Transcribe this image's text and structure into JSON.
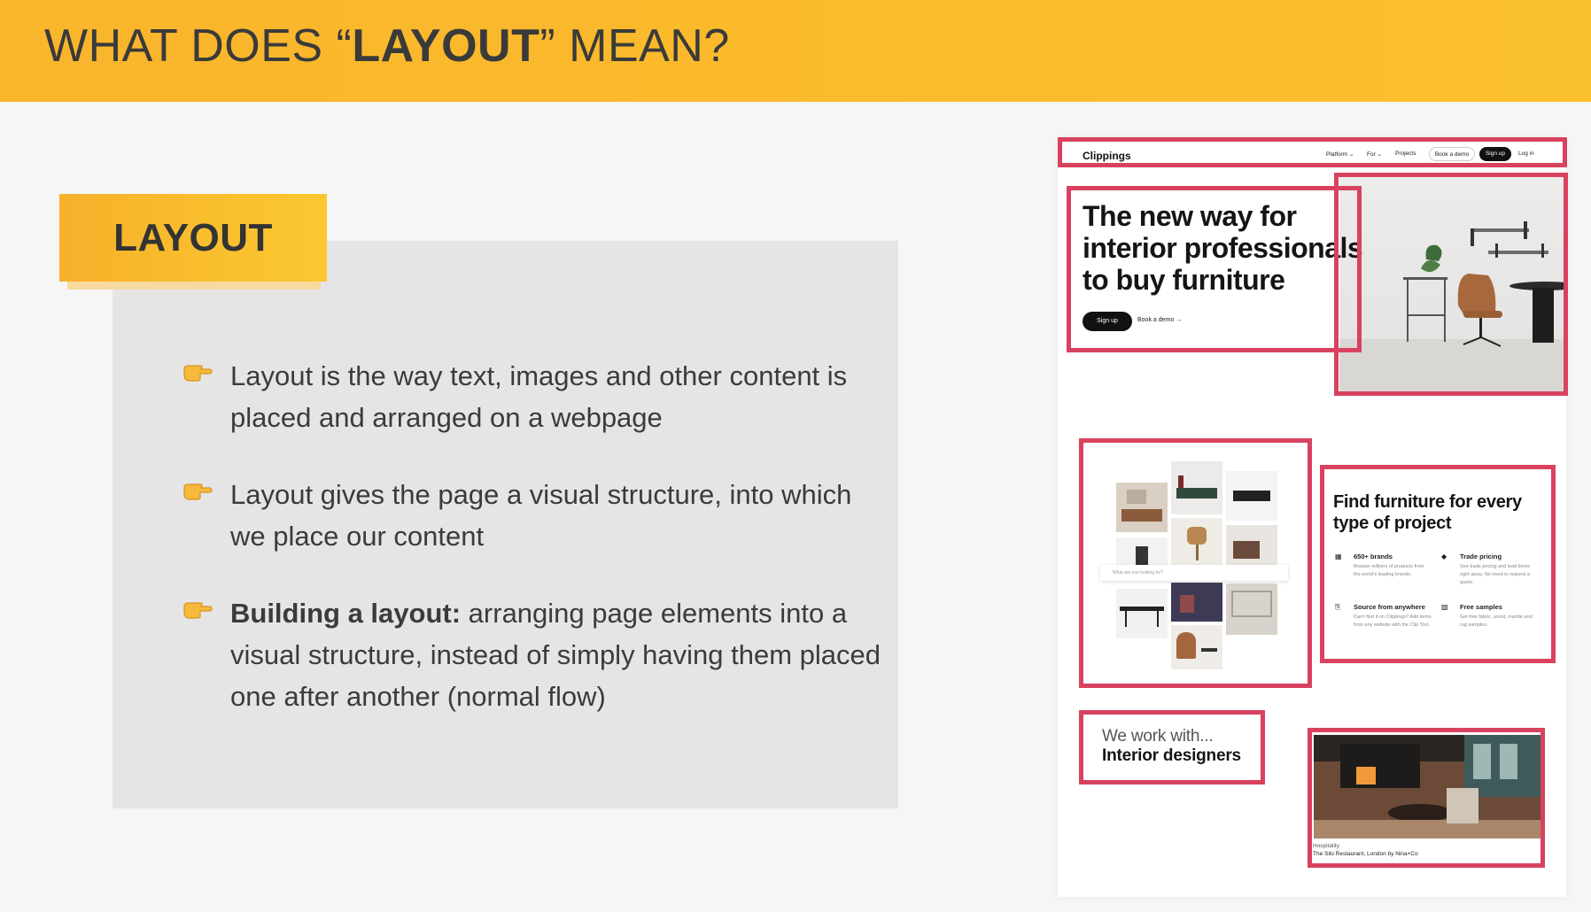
{
  "header": {
    "title_pre": "WHAT DOES “",
    "title_bold": "LAYOUT",
    "title_post": "” MEAN?"
  },
  "label": {
    "text": "LAYOUT"
  },
  "bullets": [
    {
      "bold": "",
      "text": "Layout is the way text, images and other content is placed and arranged on a webpage"
    },
    {
      "bold": "",
      "text": "Layout gives the page a visual structure, into which we place our content"
    },
    {
      "bold": "Building a layout:",
      "text": " arranging page elements into a visual structure, instead of simply having them placed one after another (normal flow)"
    }
  ],
  "site": {
    "logo": "Clippings",
    "nav": {
      "platform": "Platform",
      "for": "For",
      "projects": "Projects",
      "book_demo": "Book a demo",
      "sign_up": "Sign up",
      "log_in": "Log in"
    },
    "hero": {
      "title": "The new way for interior professionals to buy furniture",
      "sign_up": "Sign up",
      "book_demo": "Book a demo →"
    },
    "search_placeholder": "What are you looking for?",
    "find": {
      "title": "Find furniture for every type of project",
      "features": [
        {
          "icon": "grid-icon",
          "title": "650+ brands",
          "desc": "Browse millions of products from the world's leading brands."
        },
        {
          "icon": "tag-icon",
          "title": "Trade pricing",
          "desc": "See trade pricing and lead times right away. No need to request a quote."
        },
        {
          "icon": "clip-icon",
          "title": "Source from anywhere",
          "desc": "Can't find it on Clippings? Add items from any website with the Clip Tool."
        },
        {
          "icon": "swatch-icon",
          "title": "Free samples",
          "desc": "Get free fabric, wood, marble and rug samples."
        }
      ]
    },
    "work": {
      "line1": "We work with...",
      "line2": "Interior designers"
    },
    "restaurant": {
      "category": "Hospitality",
      "caption": "The Silo Restaurant, London by Nina+Co"
    }
  },
  "colors": {
    "accent": "#f9b52c",
    "highlight": "#d8425f"
  }
}
